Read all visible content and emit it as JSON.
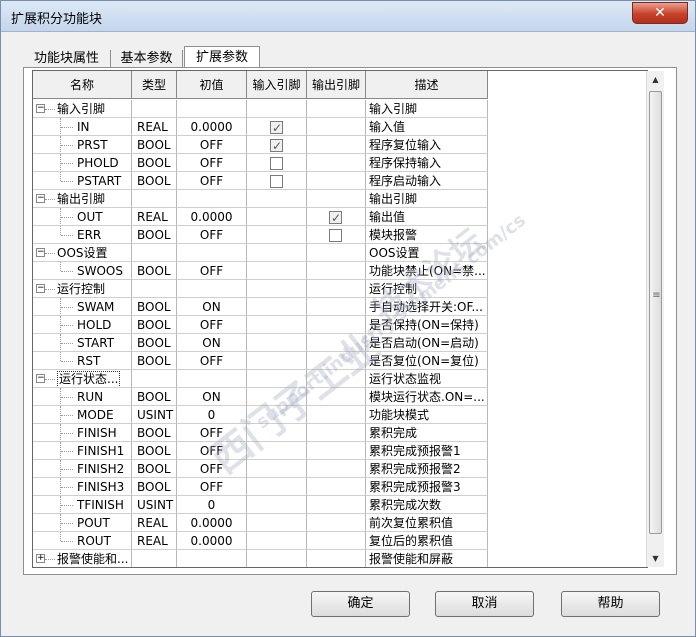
{
  "window": {
    "title": "扩展积分功能块",
    "close_glyph": "✕"
  },
  "tabs": [
    "功能块属性",
    "基本参数",
    "扩展参数"
  ],
  "active_tab": 2,
  "columns": [
    "名称",
    "类型",
    "初值",
    "输入引脚",
    "输出引脚",
    "描述"
  ],
  "rows": [
    {
      "kind": "group",
      "expander": "−",
      "name": "输入引脚",
      "type": "",
      "init": "",
      "in": "",
      "out": "",
      "desc": "输入引脚",
      "boxed": false
    },
    {
      "kind": "child",
      "name": "IN",
      "type": "REAL",
      "init": "0.0000",
      "in": "checked",
      "out": "",
      "desc": "输入值"
    },
    {
      "kind": "child",
      "name": "PRST",
      "type": "BOOL",
      "init": "OFF",
      "in": "checked",
      "out": "",
      "desc": "程序复位输入"
    },
    {
      "kind": "child",
      "name": "PHOLD",
      "type": "BOOL",
      "init": "OFF",
      "in": "unchecked",
      "out": "",
      "desc": "程序保持输入"
    },
    {
      "kind": "child",
      "name": "PSTART",
      "type": "BOOL",
      "init": "OFF",
      "in": "unchecked",
      "out": "",
      "desc": "程序启动输入",
      "last": true
    },
    {
      "kind": "group",
      "expander": "−",
      "name": "输出引脚",
      "type": "",
      "init": "",
      "in": "",
      "out": "",
      "desc": "输出引脚",
      "boxed": false
    },
    {
      "kind": "child",
      "name": "OUT",
      "type": "REAL",
      "init": "0.0000",
      "in": "",
      "out": "checked",
      "desc": "输出值"
    },
    {
      "kind": "child",
      "name": "ERR",
      "type": "BOOL",
      "init": "OFF",
      "in": "",
      "out": "unchecked",
      "desc": "模块报警",
      "last": true
    },
    {
      "kind": "group",
      "expander": "−",
      "name": "OOS设置",
      "type": "",
      "init": "",
      "in": "",
      "out": "",
      "desc": "OOS设置",
      "boxed": false
    },
    {
      "kind": "child",
      "name": "SWOOS",
      "type": "BOOL",
      "init": "OFF",
      "in": "",
      "out": "",
      "desc": "功能块禁止(ON=禁...",
      "last": true
    },
    {
      "kind": "group",
      "expander": "−",
      "name": "运行控制",
      "type": "",
      "init": "",
      "in": "",
      "out": "",
      "desc": "运行控制",
      "boxed": false
    },
    {
      "kind": "child",
      "name": "SWAM",
      "type": "BOOL",
      "init": "ON",
      "in": "",
      "out": "",
      "desc": "手自动选择开关:OF..."
    },
    {
      "kind": "child",
      "name": "HOLD",
      "type": "BOOL",
      "init": "OFF",
      "in": "",
      "out": "",
      "desc": "是否保持(ON=保持)"
    },
    {
      "kind": "child",
      "name": "START",
      "type": "BOOL",
      "init": "ON",
      "in": "",
      "out": "",
      "desc": "是否启动(ON=启动)"
    },
    {
      "kind": "child",
      "name": "RST",
      "type": "BOOL",
      "init": "OFF",
      "in": "",
      "out": "",
      "desc": "是否复位(ON=复位)",
      "last": true
    },
    {
      "kind": "group",
      "expander": "−",
      "name": "运行状态...",
      "type": "",
      "init": "",
      "in": "",
      "out": "",
      "desc": "运行状态监视",
      "boxed": true
    },
    {
      "kind": "child",
      "name": "RUN",
      "type": "BOOL",
      "init": "ON",
      "in": "",
      "out": "",
      "desc": "模块运行状态.ON=..."
    },
    {
      "kind": "child",
      "name": "MODE",
      "type": "USINT",
      "init": "0",
      "in": "",
      "out": "",
      "desc": "功能块模式"
    },
    {
      "kind": "child",
      "name": "FINISH",
      "type": "BOOL",
      "init": "OFF",
      "in": "",
      "out": "",
      "desc": "累积完成"
    },
    {
      "kind": "child",
      "name": "FINISH1",
      "type": "BOOL",
      "init": "OFF",
      "in": "",
      "out": "",
      "desc": "累积完成预报警1"
    },
    {
      "kind": "child",
      "name": "FINISH2",
      "type": "BOOL",
      "init": "OFF",
      "in": "",
      "out": "",
      "desc": "累积完成预报警2"
    },
    {
      "kind": "child",
      "name": "FINISH3",
      "type": "BOOL",
      "init": "OFF",
      "in": "",
      "out": "",
      "desc": "累积完成预报警3"
    },
    {
      "kind": "child",
      "name": "TFINISH",
      "type": "USINT",
      "init": "0",
      "in": "",
      "out": "",
      "desc": "累积完成次数"
    },
    {
      "kind": "child",
      "name": "POUT",
      "type": "REAL",
      "init": "0.0000",
      "in": "",
      "out": "",
      "desc": "前次复位累积值"
    },
    {
      "kind": "child",
      "name": "ROUT",
      "type": "REAL",
      "init": "0.0000",
      "in": "",
      "out": "",
      "desc": "复位后的累积值",
      "last": true
    },
    {
      "kind": "group",
      "expander": "+",
      "name": "报警使能和...",
      "type": "",
      "init": "",
      "in": "",
      "out": "",
      "desc": "报警使能和屏蔽",
      "boxed": false
    }
  ],
  "scrollbar": {
    "up": "▲",
    "down": "▼",
    "grip": "≡"
  },
  "buttons": {
    "ok": "确定",
    "cancel": "取消",
    "help": "帮助"
  },
  "watermark": {
    "line1": "西门子工业",
    "line2": "support.industry.siemens.com/cs",
    "line3": "技术论坛"
  }
}
